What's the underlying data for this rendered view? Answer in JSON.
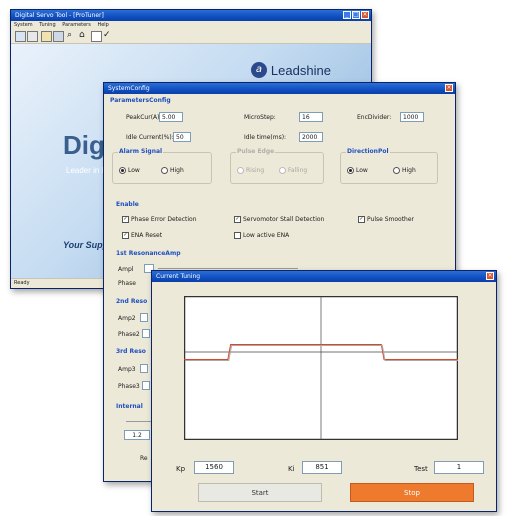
{
  "back_window": {
    "title": "Digital Servo Tool - [ProTuner]",
    "menu": [
      "System",
      "Tuning",
      "Parameters",
      "Help"
    ],
    "status_text": "Ready",
    "brand": "Leadshine",
    "hero_text": "Digi",
    "hero_subtext": "Leader in D",
    "slogan": "Your Supp"
  },
  "config_window": {
    "title": "SystemConfig",
    "params_section": "ParametersConfig",
    "peak_current_label": "PeakCur(A):",
    "peak_current_value": "5.00",
    "micro_step_label": "MicroStep:",
    "micro_step_value": "16",
    "enc_resolution_label": "EncDivider:",
    "enc_resolution_value": "1000",
    "idle_current_label": "Idle Current(%):",
    "idle_current_value": "50",
    "idle_time_label": "Idle time(ms):",
    "idle_time_value": "2000",
    "alarm_group": "Alarm Signal",
    "alarm_low": "Low",
    "alarm_high": "High",
    "pulse_group": "Pulse Edge",
    "pulse_rising": "Rising",
    "pulse_falling": "Falling",
    "direction_group": "DirectionPol",
    "direction_low": "Low",
    "direction_high": "High",
    "enable_section": "Enable",
    "phase_error": "Phase Error Detection",
    "encoder_fault": "Servomotor Stall Detection",
    "pulse_smoother": "Pulse Smoother",
    "ena_reset": "ENA Reset",
    "low_active_ena": "Low active ENA",
    "first_resonance": "1st ResonanceAmp",
    "ampl1": "Ampl",
    "phase1": "Phase",
    "second_resonance": "2nd Reso",
    "ampl2": "Amp2",
    "phase2": "Phase2",
    "third_resonance": "3rd Reso",
    "ampl3": "Amp3",
    "phase3": "Phase3",
    "internal_section": "Internal",
    "internal_value": "1.2",
    "bottom_label": "Re"
  },
  "tuning_window": {
    "title": "Current Tuning",
    "kp_label": "Kp",
    "kp_value": "1560",
    "ki_label": "Ki",
    "ki_value": "851",
    "test_label": "Test",
    "test_value": "1",
    "start_button": "Start",
    "stop_button": "Stop",
    "colors": {
      "stop_button": "#ee7a2e",
      "setpoint_line": "#d9472b",
      "response_line": "#a8a8a8"
    }
  },
  "chart_data": {
    "type": "line",
    "series": [
      {
        "values_x": [
          0,
          0.16,
          0.17,
          0.72,
          0.73,
          1.0
        ],
        "values_y": [
          -0.25,
          -0.25,
          0.25,
          0.25,
          -0.25,
          -0.25
        ]
      }
    ]
  }
}
